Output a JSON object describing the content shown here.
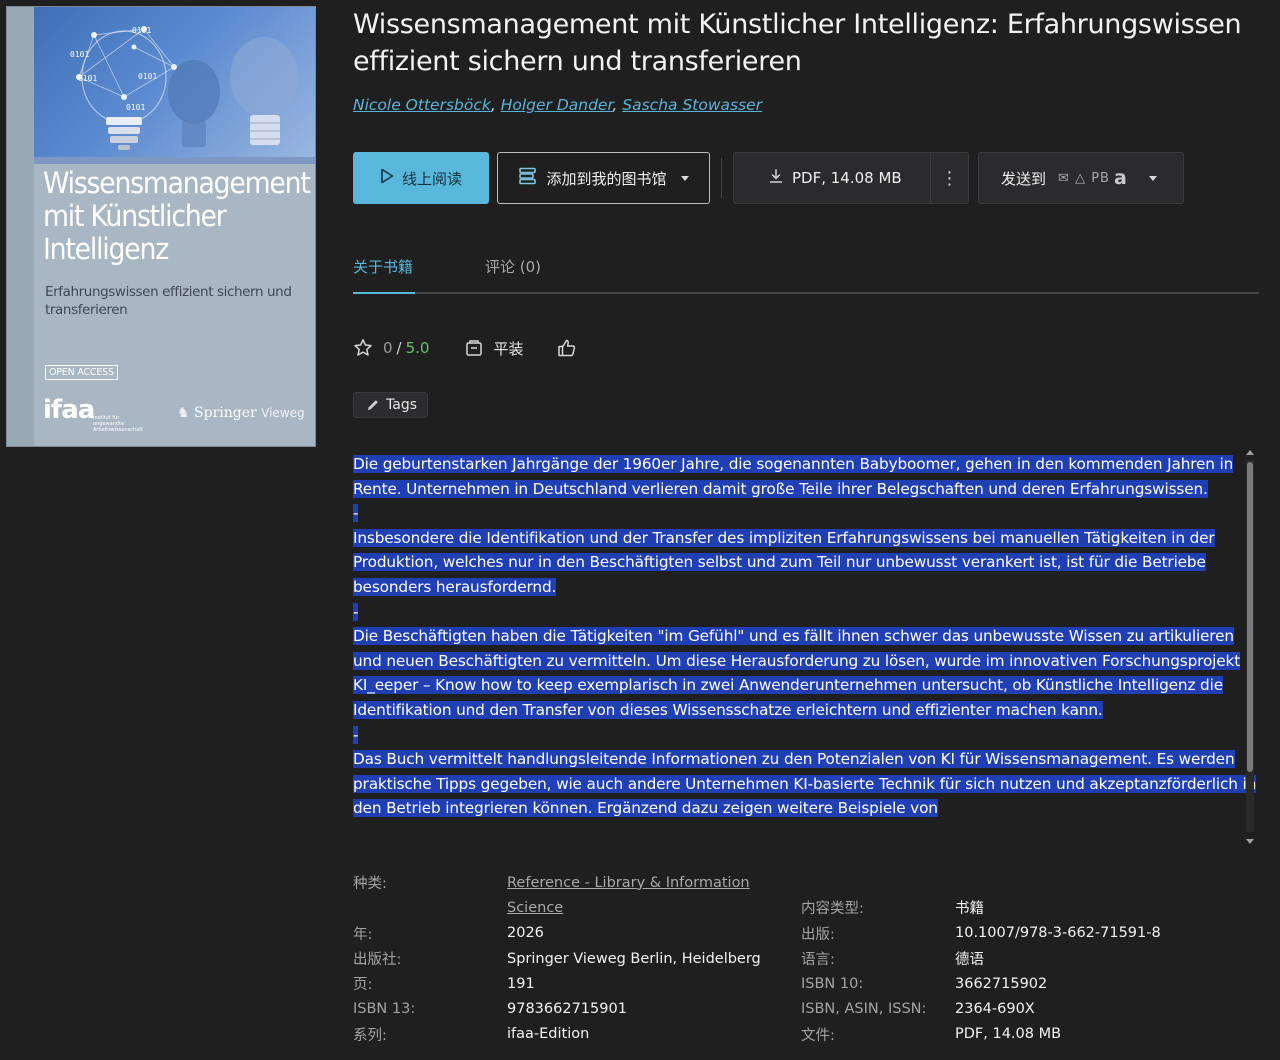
{
  "cover": {
    "title": "Wissensmanagement mit Künstlicher Intelligenz",
    "subtitle": "Erfahrungswissen effizient sichern und transferieren",
    "badge": "OPEN ACCESS",
    "ifaa": "ifaa",
    "ifaa_sub": "Institut für angewandte Arbeitswissenschaft",
    "publisher_a": "Springer",
    "publisher_b": "Vieweg",
    "binary": [
      "0101",
      "0101",
      "0101",
      "0101",
      "0101"
    ]
  },
  "book": {
    "title": "Wissensmanagement mit Künstlicher Intelligenz: Erfahrungswissen effizient sichern und transferieren",
    "authors": [
      "Nicole Ottersböck",
      "Holger Dander",
      "Sascha Stowasser"
    ]
  },
  "actions": {
    "read_online": "线上阅读",
    "add_library": "添加到我的图书馆",
    "download": "PDF, 14.08 MB",
    "send_to": "发送到",
    "send_pb": "PB",
    "send_amazon": "a"
  },
  "tabs": {
    "about": "关于书籍",
    "comments": "评论 (0)"
  },
  "rating": {
    "value": "0",
    "separator": "/",
    "max": "5.0",
    "binding": "平装"
  },
  "tags_label": "Tags",
  "description": [
    "Die geburtenstarken Jahrgänge der 1960er Jahre, die sogenannten Babyboomer, gehen in den kommenden Jahren in Rente. Unternehmen in Deutschland verlieren damit große Teile ihrer Belegschaften und deren Erfahrungswissen.",
    "-",
    "Insbesondere die Identifikation und der Transfer des impliziten Erfahrungswissens bei manuellen Tätigkeiten in der Produktion, welches nur in den Beschäftigten selbst und zum Teil nur unbewusst verankert ist, ist für die Betriebe besonders herausfordernd.",
    "-",
    "Die Beschäftigten haben die Tätigkeiten \"im Gefühl\" und es fällt ihnen schwer das unbewusste Wissen zu artikulieren und neuen Beschäftigten zu vermitteln. Um diese Herausforderung zu lösen, wurde im innovativen Forschungsprojekt KI_eeper – Know how to keep exemplarisch in zwei Anwenderunternehmen untersucht, ob Künstliche Intelligenz die Identifikation und den Transfer von dieses Wissensschatze erleichtern und effizienter machen kann.",
    "-",
    "Das Buch vermittelt handlungsleitende  Informationen zu den Potenzialen von KI für Wissensmanagement. Es werden praktische Tipps gegeben, wie auch andere Unternehmen KI-basierte Technik für sich nutzen und akzeptanzförderlich in den Betrieb integrieren können.  Ergänzend dazu zeigen weitere Beispiele von"
  ],
  "metadata": {
    "category_label": "种类:",
    "category_1": "Reference - Library & Information",
    "category_2": "Science",
    "content_type_label": "内容类型:",
    "content_type": "书籍",
    "year_label": "年:",
    "year": "2026",
    "edition_label": "出版:",
    "edition": "10.1007/978-3-662-71591-8",
    "publisher_label": "出版社:",
    "publisher": "Springer Vieweg Berlin, Heidelberg",
    "language_label": "语言:",
    "language": "德语",
    "pages_label": "页:",
    "pages": "191",
    "isbn10_label": "ISBN 10:",
    "isbn10": "3662715902",
    "isbn13_label": "ISBN 13:",
    "isbn13": "9783662715901",
    "issn_label": "ISBN, ASIN, ISSN:",
    "issn": "2364-690X",
    "series_label": "系列:",
    "series": "ifaa-Edition",
    "file_label": "文件:",
    "file": "PDF, 14.08 MB"
  },
  "colors": {
    "accent": "#58b7db",
    "background": "#1f1f20",
    "selection": "#1f3fb3",
    "rating_max": "#6cc070"
  }
}
